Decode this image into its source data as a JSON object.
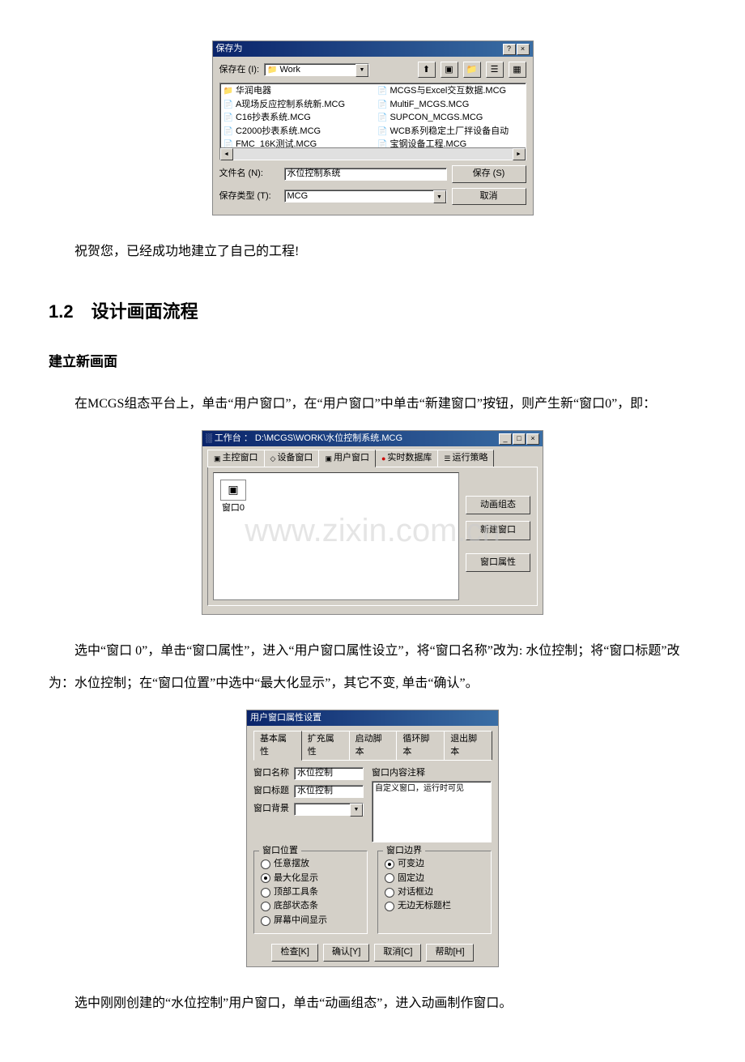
{
  "save_dialog": {
    "title": "保存为",
    "save_in_label": "保存在 (I):",
    "save_in_value": "Work",
    "files_left": [
      {
        "type": "folder",
        "name": "华润电器"
      },
      {
        "type": "doc",
        "name": "A现场反应控制系统新.MCG"
      },
      {
        "type": "doc",
        "name": "C16抄表系统.MCG"
      },
      {
        "type": "doc",
        "name": "C2000抄表系统.MCG"
      },
      {
        "type": "doc",
        "name": "FMC_16K测试.MCG"
      }
    ],
    "files_right": [
      {
        "type": "doc",
        "name": "MCGS与Excel交互数据.MCG"
      },
      {
        "type": "doc",
        "name": "MultiF_MCGS.MCG"
      },
      {
        "type": "doc",
        "name": "SUPCON_MCGS.MCG"
      },
      {
        "type": "doc",
        "name": "WCB系列稳定土厂拌设备自动"
      },
      {
        "type": "doc",
        "name": "宝钢设备工程.MCG"
      }
    ],
    "filename_label": "文件名 (N):",
    "filename_value": "水位控制系统",
    "filetype_label": "保存类型 (T):",
    "filetype_value": "MCG",
    "save_btn": "保存 (S)",
    "cancel_btn": "取消"
  },
  "doc": {
    "para1": "祝贺您，已经成功地建立了自己的工程!",
    "heading2": "1.2　设计画面流程",
    "heading3": "建立新画面",
    "para2": "在MCGS组态平台上，单击“用户窗口”，在“用户窗口”中单击“新建窗口”按钮，则产生新“窗口0”，即：",
    "para3": "选中“窗口 0”，单击“窗口属性”，进入“用户窗口属性设立”，将“窗口名称”改为: 水位控制；将“窗口标题”改为：水位控制；在“窗口位置”中选中“最大化显示”，其它不变, 单击“确认”。",
    "para4": "选中刚刚创建的“水位控制”用户窗口，单击“动画组态”，进入动画制作窗口。"
  },
  "workbench": {
    "title": "工作台 ： D:\\MCGS\\WORK\\水位控制系统.MCG",
    "tabs": {
      "main": "主控窗口",
      "device": "设备窗口",
      "user": "用户窗口",
      "realtime": "实时数据库",
      "strategy": "运行策略"
    },
    "window0": "窗口0",
    "btn_anim": "动画组态",
    "btn_new": "新建窗口",
    "btn_prop": "窗口属性",
    "watermark": "www.zixin.com.cn"
  },
  "propdlg": {
    "title": "用户窗口属性设置",
    "tabs": {
      "basic": "基本属性",
      "extend": "扩充属性",
      "startup": "启动脚本",
      "loop": "循环脚本",
      "exit": "退出脚本"
    },
    "name_label": "窗口名称",
    "name_value": "水位控制",
    "caption_label": "窗口标题",
    "caption_value": "水位控制",
    "bg_label": "窗口背景",
    "note_label": "窗口内容注释",
    "note_value": "自定义窗口，运行时可见",
    "pos_group": "窗口位置",
    "pos_options": {
      "free": "任意摆放",
      "max": "最大化显示",
      "toptool": "顶部工具条",
      "bottomstatus": "底部状态条",
      "center": "屏幕中间显示"
    },
    "border_group": "窗口边界",
    "border_options": {
      "variable": "可变边",
      "fixed": "固定边",
      "dialog": "对话框边",
      "none": "无边无标题栏"
    },
    "btns": {
      "check": "检查[K]",
      "confirm": "确认[Y]",
      "cancel": "取消[C]",
      "help": "帮助[H]"
    }
  }
}
